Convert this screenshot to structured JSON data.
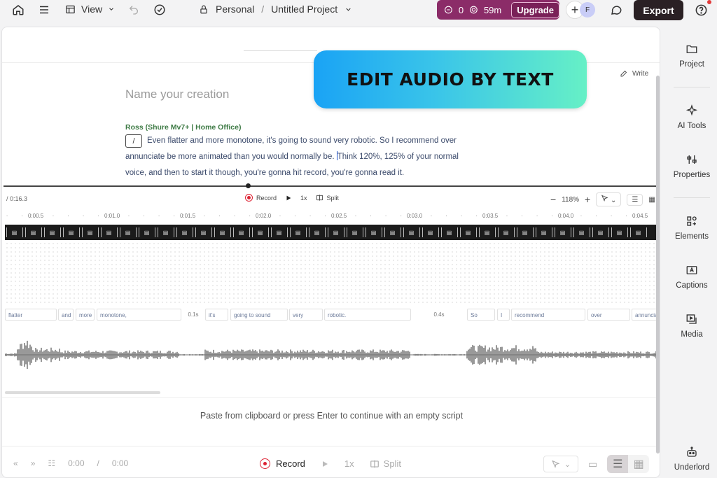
{
  "topbar": {
    "view_label": "View",
    "workspace": "Personal",
    "separator": "/",
    "project_title": "Untitled Project",
    "credits_count": "0",
    "time_left": "59m",
    "upgrade_label": "Upgrade",
    "avatar_letter": "F",
    "export_label": "Export"
  },
  "editor": {
    "banner_text": "EDIT AUDIO BY TEXT",
    "write_label": "Write",
    "title_placeholder": "Name your creation",
    "speaker": "Ross (Shure Mv7+ | Home Office)",
    "slash": "/",
    "text_before_caret": "Even flatter and more monotone, it's going to sound very robotic. So I recommend over annunciate be more animated than you would normally be. ",
    "text_after_caret": "Think 120%, 125% of your normal voice, and then to start it though, you're gonna hit record, you're gonna read it."
  },
  "toolbar": {
    "time": "/ 0:16.3",
    "record_label": "Record",
    "speed": "1x",
    "split_label": "Split",
    "zoom": "118%"
  },
  "ruler": [
    "0:00.5",
    "0:01.0",
    "0:01.5",
    "0:02.0",
    "0:02.5",
    "0:03.0",
    "0:03.5",
    "0:04.0",
    "0:04.5"
  ],
  "words": [
    {
      "text": "flatter"
    },
    {
      "text": "and"
    },
    {
      "text": "more"
    },
    {
      "text": "monotone,"
    },
    {
      "text": "0.1s",
      "gap": true
    },
    {
      "text": "it's"
    },
    {
      "text": "going to sound"
    },
    {
      "text": "very"
    },
    {
      "text": "robotic."
    },
    {
      "text": "0.4s",
      "gap": true
    },
    {
      "text": "So"
    },
    {
      "text": "I"
    },
    {
      "text": "recommend"
    },
    {
      "text": "over"
    },
    {
      "text": "annuncia"
    }
  ],
  "paste_hint": "Paste from clipboard or press Enter to continue with an empty script",
  "bottom": {
    "current_time": "0:00",
    "separator": "/",
    "total_time": "0:00",
    "record_label": "Record",
    "speed": "1x",
    "split_label": "Split"
  },
  "sidebar": {
    "items": [
      {
        "label": "Project",
        "icon": "folder-icon"
      },
      {
        "label": "AI Tools",
        "icon": "sparkle-icon"
      },
      {
        "label": "Properties",
        "icon": "sliders-icon"
      },
      {
        "label": "Elements",
        "icon": "shapes-icon"
      },
      {
        "label": "Captions",
        "icon": "captions-icon"
      },
      {
        "label": "Media",
        "icon": "media-icon"
      },
      {
        "label": "Underlord",
        "icon": "robot-icon"
      }
    ]
  },
  "colors": {
    "accent_brand": "#8b2c68",
    "record_red": "#d22233",
    "speaker_green": "#3d7a44"
  }
}
